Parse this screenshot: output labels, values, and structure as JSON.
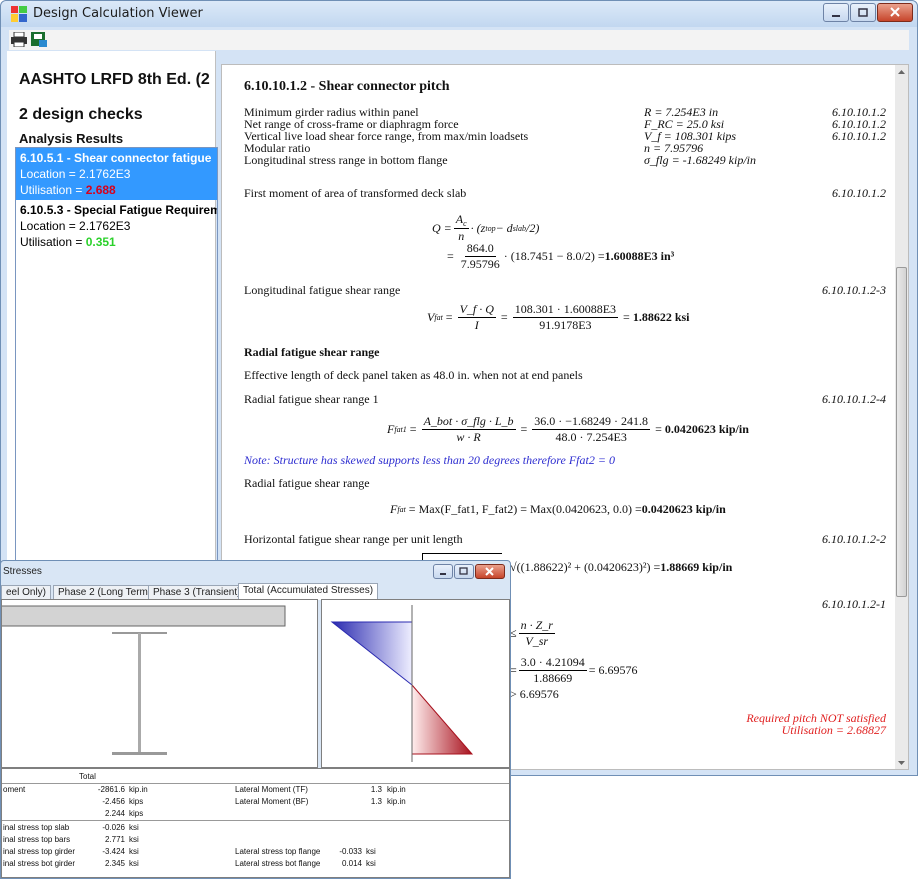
{
  "window": {
    "title": "Design Calculation Viewer"
  },
  "left": {
    "code": "AASHTO LRFD 8th Ed. (2",
    "count": "2 design checks",
    "section": "Analysis Results",
    "checks": [
      {
        "title": "6.10.5.1 - Shear connector fatigue",
        "location": "Location = 2.1762E3",
        "util_label": "Utilisation = ",
        "util_value": "2.688"
      },
      {
        "title": "6.10.5.3 - Special Fatigue Requirem",
        "location": "Location = 2.1762E3",
        "util_label": "Utilisation = ",
        "util_value": "0.351"
      }
    ]
  },
  "report": {
    "heading": "6.10.10.1.2 - Shear connector pitch",
    "params": [
      {
        "label": "Minimum girder radius within panel",
        "value": "R = 7.254E3 in",
        "ref": "6.10.10.1.2"
      },
      {
        "label": "Net range of cross-frame or diaphragm force",
        "value": "F_RC = 25.0 ksi",
        "ref": "6.10.10.1.2"
      },
      {
        "label": "Vertical live load shear force range, from max/min loadsets",
        "value": "V_f = 108.301 kips",
        "ref": "6.10.10.1.2"
      },
      {
        "label": "Modular ratio",
        "value": "n = 7.95796",
        "ref": ""
      },
      {
        "label": "Longitudinal stress range in bottom flange",
        "value": "σ_flg = -1.68249 kip/in",
        "ref": ""
      }
    ],
    "first_moment": {
      "label": "First moment of area of transformed deck slab",
      "ref": "6.10.10.1.2",
      "q": "Q =",
      "ac": "A",
      "n": "n",
      "expr1": "· (z",
      "expr1b": "top",
      "expr1c": " − d",
      "expr1d": "slab",
      "expr1e": "/2)",
      "num": "864.0",
      "den": "7.95796",
      "expr2": "· (18.7451 − 8.0/2) = ",
      "result": "1.60088E3 in³"
    },
    "long_fat": {
      "label": "Longitudinal fatigue shear range",
      "ref": "6.10.10.1.2-3",
      "lhs": "V",
      "lhs_sub": "fat",
      "num1": "V_f · Q",
      "den1": "I",
      "num2": "108.301 · 1.60088E3",
      "den2": "91.9178E3",
      "result": "1.88622 ksi"
    },
    "radial_heading": "Radial fatigue shear range",
    "eff_length": "Effective length of deck panel taken as  48.0  in. when not at end panels",
    "radial1": {
      "label": "Radial fatigue shear range 1",
      "ref": "6.10.10.1.2-4",
      "lhs": "F",
      "lhs_sub": "fat1",
      "num1": "A_bot · σ_flg · L_b",
      "den1": "w · R",
      "num2": "36.0 · −1.68249 · 241.8",
      "den2": "48.0 · 7.254E3",
      "result": "0.0420623 kip/in"
    },
    "note": "Note: Structure has skewed supports less than 20 degrees therefore Ffat2 = 0",
    "radial": {
      "label": "Radial fatigue shear range",
      "expr": "= Max(F_fat1, F_fat2) = Max(0.0420623, 0.0) = ",
      "lhs": "F",
      "lhs_sub": "fat",
      "result": "0.0420623 kip/in"
    },
    "horiz": {
      "label": "Horizontal fatigue shear range per unit length",
      "ref": "6.10.10.1.2-2",
      "expr": "√((1.88622)² + (0.0420623)²) = ",
      "result": "1.88669 kip/in"
    },
    "pitch": {
      "ref": "6.10.10.1.2-1",
      "le": "≤",
      "num1": "n · Z_r",
      "den1": "V_sr",
      "eqs": "=",
      "num2": "3.0 · 4.21094",
      "den2": "1.88669",
      "res": "= 6.69576",
      "gt": "> 6.69576"
    },
    "fail1": "Required pitch NOT satisfied",
    "fail2": "Utilisation = 2.68827"
  },
  "stress_window": {
    "title": "Stresses",
    "tabs": [
      "eel Only)",
      "Phase 2 (Long Term)",
      "Phase 3 (Transient)",
      "Total (Accumulated Stresses)"
    ],
    "table_header": "Total",
    "rows_left": [
      {
        "label": "oment",
        "value": "-2861.6",
        "unit": "kip.in"
      },
      {
        "label": "",
        "value": "-2.456",
        "unit": "kips"
      },
      {
        "label": "",
        "value": "2.244",
        "unit": "kips"
      },
      {
        "label": "inal stress top slab",
        "value": "-0.026",
        "unit": "ksi"
      },
      {
        "label": "inal stress top bars",
        "value": "2.771",
        "unit": "ksi"
      },
      {
        "label": "inal stress top girder",
        "value": "-3.424",
        "unit": "ksi"
      },
      {
        "label": "inal stress bot girder",
        "value": "2.345",
        "unit": "ksi"
      }
    ],
    "rows_right": [
      {
        "label": "Lateral Moment (TF)",
        "value": "1.3",
        "unit": "kip.in"
      },
      {
        "label": "Lateral Moment (BF)",
        "value": "1.3",
        "unit": "kip.in"
      },
      {
        "label": "Lateral stress top flange",
        "value": "-0.033",
        "unit": "ksi"
      },
      {
        "label": "Lateral stress bot flange",
        "value": "0.014",
        "unit": "ksi"
      }
    ]
  }
}
